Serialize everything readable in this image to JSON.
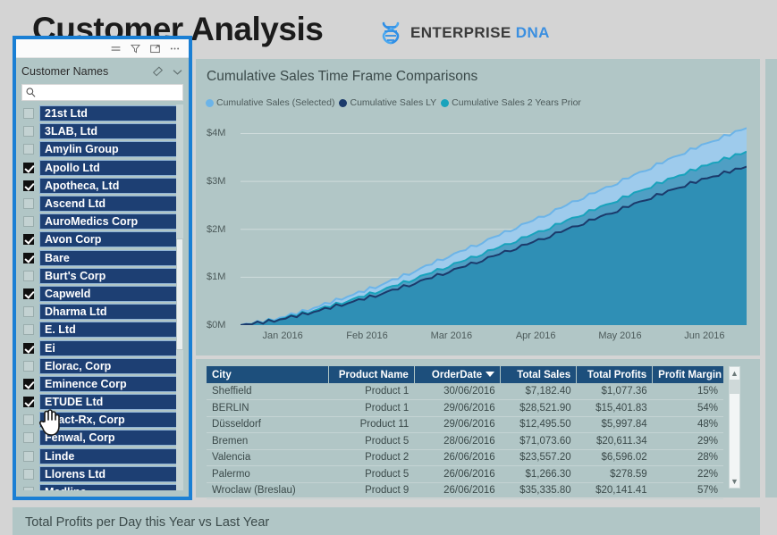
{
  "header": {
    "title": "Customer Analysis",
    "brand_enterprise": "ENTERPRISE",
    "brand_dna": "DNA",
    "brand_icon": "dna-helix-icon"
  },
  "slicer": {
    "toolbar_icons": [
      "menu-lines-icon",
      "filter-funnel-icon",
      "focus-mode-icon",
      "more-options-icon"
    ],
    "title": "Customer Names",
    "eraser_icon": "eraser-icon",
    "chevron_icon": "chevron-down-icon",
    "search_icon": "search-icon",
    "search_value": "",
    "search_placeholder": "",
    "items": [
      {
        "label": "21st Ltd",
        "checked": false
      },
      {
        "label": "3LAB, Ltd",
        "checked": false
      },
      {
        "label": "Amylin Group",
        "checked": false
      },
      {
        "label": "Apollo Ltd",
        "checked": true
      },
      {
        "label": "Apotheca, Ltd",
        "checked": true
      },
      {
        "label": "Ascend Ltd",
        "checked": false
      },
      {
        "label": "AuroMedics Corp",
        "checked": false
      },
      {
        "label": "Avon Corp",
        "checked": true
      },
      {
        "label": "Bare",
        "checked": true
      },
      {
        "label": "Burt's Corp",
        "checked": false
      },
      {
        "label": "Capweld",
        "checked": true
      },
      {
        "label": "Dharma Ltd",
        "checked": false
      },
      {
        "label": "E. Ltd",
        "checked": false
      },
      {
        "label": "Ei",
        "checked": true
      },
      {
        "label": "Elorac, Corp",
        "checked": false
      },
      {
        "label": "Eminence Corp",
        "checked": true
      },
      {
        "label": "ETUDE Ltd",
        "checked": true
      },
      {
        "label": "Exact-Rx, Corp",
        "checked": false
      },
      {
        "label": "Fenwal, Corp",
        "checked": false
      },
      {
        "label": "Linde",
        "checked": false
      },
      {
        "label": "Llorens Ltd",
        "checked": false
      },
      {
        "label": "Medline",
        "checked": false
      }
    ],
    "cursor_icon": "hand-pointer-cursor"
  },
  "chart_data": {
    "type": "area",
    "title": "Cumulative Sales Time Frame Comparisons",
    "xlabel": "",
    "ylabel": "",
    "ylim": [
      0,
      4400000
    ],
    "yticks": [
      "$0M",
      "$1M",
      "$2M",
      "$3M",
      "$4M"
    ],
    "ytick_values": [
      0,
      1000000,
      2000000,
      3000000,
      4000000
    ],
    "categories": [
      "Jan 2016",
      "Feb 2016",
      "Mar 2016",
      "Apr 2016",
      "May 2016",
      "Jun 2016"
    ],
    "grid": true,
    "legend_position": "top-left",
    "series": [
      {
        "name": "Cumulative Sales (Selected)",
        "color": "#6cb4e8",
        "values": [
          0,
          120000,
          320000,
          560000,
          800000,
          1080000,
          1390000,
          1680000,
          1990000,
          2290000,
          2620000,
          2920000,
          3240000,
          3560000,
          3850000,
          4120000
        ]
      },
      {
        "name": "Cumulative Sales LY",
        "color": "#1b3a6b",
        "values": [
          0,
          95000,
          250000,
          430000,
          620000,
          840000,
          1080000,
          1320000,
          1570000,
          1820000,
          2090000,
          2350000,
          2620000,
          2880000,
          3110000,
          3310000
        ]
      },
      {
        "name": "Cumulative Sales 2 Years Prior",
        "color": "#18a3bc",
        "values": [
          0,
          105000,
          275000,
          470000,
          690000,
          930000,
          1190000,
          1450000,
          1720000,
          1990000,
          2280000,
          2560000,
          2850000,
          3130000,
          3390000,
          3620000
        ]
      }
    ]
  },
  "table": {
    "columns": [
      {
        "label": "City",
        "align": "left",
        "sorted": false
      },
      {
        "label": "Product Name",
        "align": "right",
        "sorted": false
      },
      {
        "label": "OrderDate",
        "align": "right",
        "sorted": true,
        "sort_icon": "sort-descending-icon"
      },
      {
        "label": "Total Sales",
        "align": "right",
        "sorted": false
      },
      {
        "label": "Total Profits",
        "align": "right",
        "sorted": false
      },
      {
        "label": "Profit Margin",
        "align": "right",
        "sorted": false
      }
    ],
    "rows": [
      {
        "city": "Sheffield",
        "product": "Product 1",
        "date": "30/06/2016",
        "sales": "$7,182.40",
        "profits": "$1,077.36",
        "margin": "15%"
      },
      {
        "city": "BERLIN",
        "product": "Product 1",
        "date": "29/06/2016",
        "sales": "$28,521.90",
        "profits": "$15,401.83",
        "margin": "54%"
      },
      {
        "city": "Düsseldorf",
        "product": "Product 11",
        "date": "29/06/2016",
        "sales": "$12,495.50",
        "profits": "$5,997.84",
        "margin": "48%"
      },
      {
        "city": "Bremen",
        "product": "Product 5",
        "date": "28/06/2016",
        "sales": "$71,073.60",
        "profits": "$20,611.34",
        "margin": "29%"
      },
      {
        "city": "Valencia",
        "product": "Product 2",
        "date": "26/06/2016",
        "sales": "$23,557.20",
        "profits": "$6,596.02",
        "margin": "28%"
      },
      {
        "city": "Palermo",
        "product": "Product 5",
        "date": "26/06/2016",
        "sales": "$1,266.30",
        "profits": "$278.59",
        "margin": "22%"
      },
      {
        "city": "Wroclaw (Breslau)",
        "product": "Product 9",
        "date": "26/06/2016",
        "sales": "$35,335.80",
        "profits": "$20,141.41",
        "margin": "57%"
      }
    ],
    "scroll_up_icon": "chevron-up-icon",
    "scroll_down_icon": "chevron-down-icon"
  },
  "bottom": {
    "title": "Total Profits per Day this Year vs Last Year"
  },
  "colors": {
    "page_bg": "#d4d4d4",
    "panel_bg": "#b1c6c6",
    "selection_outline": "#1a7fd4",
    "slicer_item_bg": "#1d3f73",
    "table_header_bg": "#1d4f7c",
    "series_selected": "#6cb4e8",
    "series_ly": "#1b3a6b",
    "series_2y": "#18a3bc",
    "brand_blue": "#3b8fe0"
  }
}
